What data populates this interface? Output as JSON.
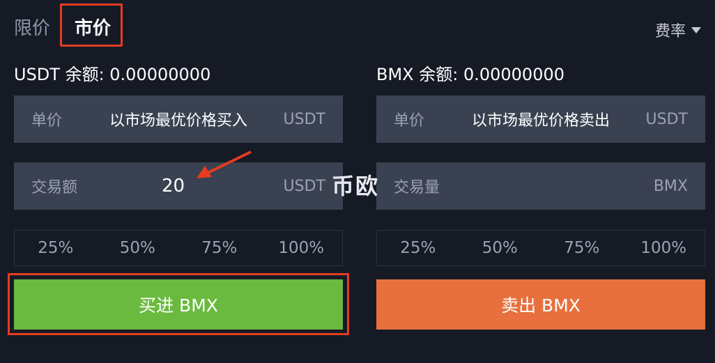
{
  "tabs": {
    "limit": "限价",
    "market": "市价"
  },
  "fee_label": "费率",
  "buy": {
    "balance": "USDT 余额: 0.00000000",
    "price_label": "单价",
    "price_value": "以市场最优价格买入",
    "price_unit": "USDT",
    "amount_label": "交易额",
    "amount_value": "20",
    "amount_unit": "USDT",
    "percents": [
      "25%",
      "50%",
      "75%",
      "100%"
    ],
    "button": "买进 BMX"
  },
  "sell": {
    "balance": "BMX 余额: 0.00000000",
    "price_label": "单价",
    "price_value": "以市场最优价格卖出",
    "price_unit": "USDT",
    "amount_label": "交易量",
    "amount_unit": "BMX",
    "percents": [
      "25%",
      "50%",
      "75%",
      "100%"
    ],
    "button": "卖出 BMX"
  },
  "watermark": "币欧",
  "colors": {
    "background": "#161a25",
    "field": "#3a4150",
    "buy": "#6aba3f",
    "sell": "#e8703e",
    "highlight": "#e53c1f"
  }
}
